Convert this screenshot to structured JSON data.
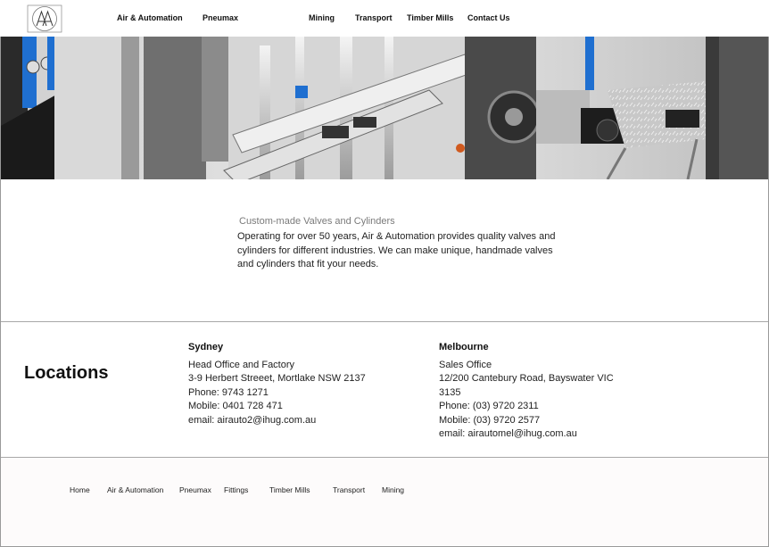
{
  "nav": {
    "items": [
      "Air & Automation",
      "Pneumax",
      "Mining",
      "Transport",
      "Timber Mills",
      "Contact Us"
    ]
  },
  "intro": {
    "title": "Custom-made Valves and Cylinders",
    "body": "Operating for over 50 years, Air & Automation provides quality valves and cylinders for different industries. We can make unique, handmade valves and cylinders that fit your needs."
  },
  "locations": {
    "heading": "Locations",
    "sydney": {
      "city": "Sydney",
      "label": "Head Office and Factory",
      "address": "3-9 Herbert Streeet, Mortlake NSW 2137",
      "phone": "Phone: 9743 1271",
      "mobile": "Mobile: 0401 728 471",
      "email": "email: airauto2@ihug.com.au"
    },
    "melbourne": {
      "city": "Melbourne",
      "label": "Sales Office",
      "address_line1": "12/200 Cantebury Road, Bayswater VIC",
      "address_line2": "3135",
      "phone": "Phone: (03) 9720 2311",
      "mobile": "Mobile: (03) 9720 2577",
      "email": "email: airautomel@ihug.com.au"
    }
  },
  "footer": {
    "links": [
      "Home",
      "Air & Automation",
      "Pneumax",
      "Fittings",
      "Timber Mills",
      "Transport",
      "Mining"
    ]
  },
  "colors": {
    "text": "#111111",
    "muted": "#7a7a7a",
    "divider": "#a8a8a8",
    "hero_accent": "#1f6fd0"
  }
}
